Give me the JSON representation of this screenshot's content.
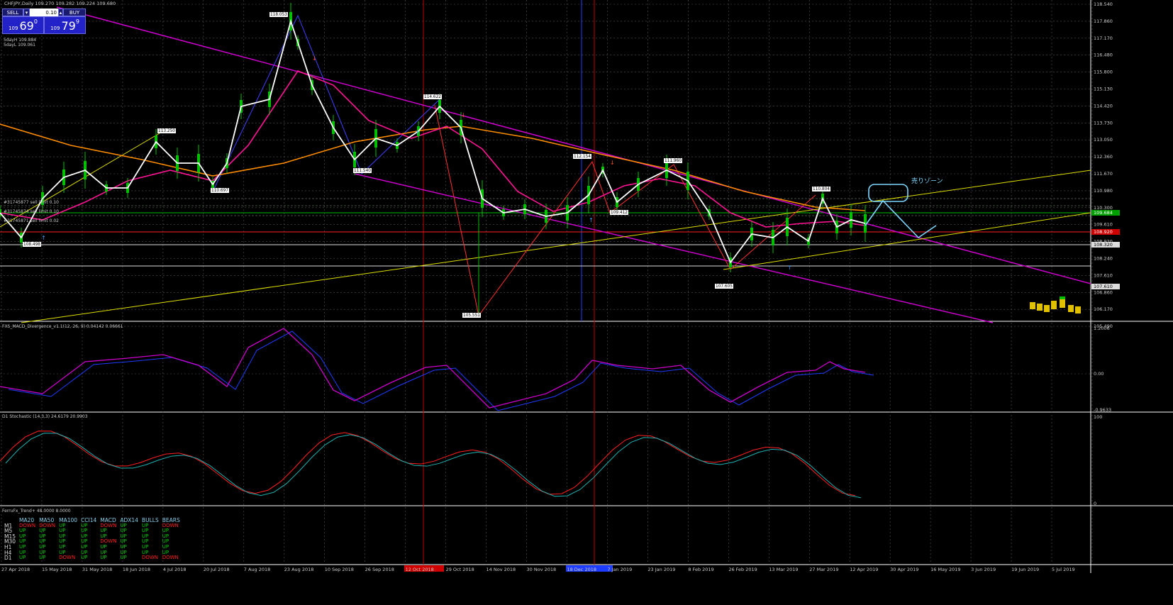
{
  "chart_header": {
    "title": "CHFJPY,Daily  109.270 109.282 109.224 109.680"
  },
  "trade_panel": {
    "sell_label": "SELL",
    "buy_label": "BUY",
    "lot_value": "0.10",
    "sell_prefix": "109",
    "sell_big": "69",
    "sell_sup": "0",
    "buy_prefix": "109",
    "buy_big": "79",
    "buy_sup": "9"
  },
  "info": {
    "sday_high": "5dayH 109.884",
    "sday_low": "5dayL 109.061",
    "sell_limit_1": "#31745877 sell limit 0.10",
    "sell_limit_2": "#31745874 sell limit 0.10",
    "sell_limit_3": "#31745871 sell limit 0.02"
  },
  "price_scale": [
    "118.540",
    "117.860",
    "117.170",
    "116.480",
    "115.800",
    "115.130",
    "114.420",
    "113.730",
    "113.050",
    "112.360",
    "111.670",
    "110.980",
    "110.300",
    "109.610",
    "108.920",
    "108.240",
    "107.610",
    "106.860",
    "106.170",
    "105.490"
  ],
  "price_markers": {
    "green": "109.684",
    "red": "108.920",
    "white1": "108.320",
    "white2": "107.610",
    "grey": "109.220"
  },
  "swing_labels": [
    "118.053",
    "113.250",
    "110.697",
    "108.498",
    "111.540",
    "114.622",
    "105.551",
    "112.154",
    "109.412",
    "111.960",
    "110.804",
    "107.605"
  ],
  "zone_label": "売りゾーン",
  "macd": {
    "title": "FXS_MACD_Divergence_v1.1(12, 26, 9) 0.04142 0.06661",
    "scale": [
      "1.2006",
      "0.00",
      "-0.9633"
    ]
  },
  "stoch": {
    "title": "D1 Stochastic (14,3,3) 24.6179 20.9903",
    "scale": [
      "100",
      "0"
    ]
  },
  "trend": {
    "title": "FerruFx_Trend+ 48.0000 8.0000",
    "headers": [
      "MA20",
      "MA50",
      "MA100",
      "CCI14",
      "MACD",
      "ADX14",
      "BULLS",
      "BEARS"
    ],
    "rows": [
      {
        "tf": "M1",
        "vals": [
          "DOWN",
          "DOWN",
          "UP",
          "UP",
          "DOWN",
          "UP",
          "UP",
          "DOWN"
        ]
      },
      {
        "tf": "M5",
        "vals": [
          "UP",
          "UP",
          "UP",
          "UP",
          "UP",
          "UP",
          "UP",
          "UP"
        ]
      },
      {
        "tf": "M15",
        "vals": [
          "UP",
          "UP",
          "UP",
          "UP",
          "UP",
          "UP",
          "UP",
          "UP"
        ]
      },
      {
        "tf": "M30",
        "vals": [
          "UP",
          "UP",
          "UP",
          "UP",
          "DOWN",
          "UP",
          "UP",
          "UP"
        ]
      },
      {
        "tf": "H1",
        "vals": [
          "UP",
          "UP",
          "UP",
          "UP",
          "UP",
          "UP",
          "UP",
          "UP"
        ]
      },
      {
        "tf": "H4",
        "vals": [
          "UP",
          "UP",
          "UP",
          "UP",
          "UP",
          "UP",
          "UP",
          "UP"
        ]
      },
      {
        "tf": "D1",
        "vals": [
          "UP",
          "UP",
          "DOWN",
          "UP",
          "UP",
          "UP",
          "DOWN",
          "DOWN"
        ]
      }
    ]
  },
  "date_axis": [
    "27 Apr 2018",
    "15 May 2018",
    "31 May 2018",
    "18 Jun 2018",
    "4 Jul 2018",
    "20 Jul 2018",
    "7 Aug 2018",
    "23 Aug 2018",
    "10 Sep 2018",
    "26 Sep 2018",
    "12 Oct 2018",
    "29 Oct 2018",
    "14 Nov 2018",
    "30 Nov 2018",
    "18 Dec 2018",
    "7 Jan 2019",
    "23 Jan 2019",
    "8 Feb 2019",
    "26 Feb 2019",
    "13 Mar 2019",
    "27 Mar 2019",
    "12 Apr 2019",
    "30 Apr 2019",
    "16 May 2019",
    "3 Jun 2019",
    "19 Jun 2019",
    "5 Jul 2019"
  ],
  "colors": {
    "candle_up": "#00c000",
    "price_line": "#ffffff",
    "ma_pink": "#ff1493",
    "ma_orange": "#ff8c00",
    "channel": "#cc00cc",
    "trend_yellow": "#e0e000",
    "macd_blue": "#1e3cff",
    "stoch_red": "#ff2020",
    "stoch_cyan": "#20b0b0",
    "zone_cyan": "#7fd8ff"
  }
}
